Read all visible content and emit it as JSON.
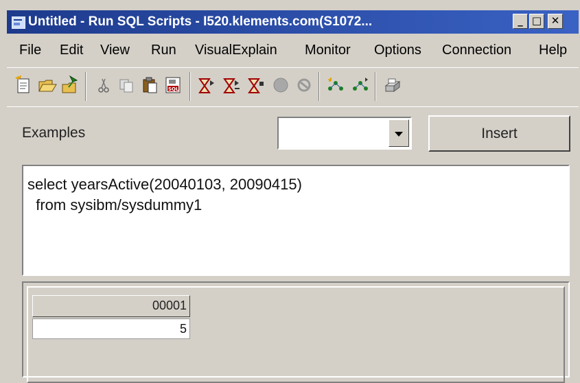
{
  "window": {
    "title": "Untitled - Run SQL Scripts - I520.klements.com(S1072...",
    "minimize_glyph": "_",
    "maximize_glyph": "□",
    "close_glyph": "✕"
  },
  "menu": [
    "File",
    "Edit",
    "View",
    "Run",
    "VisualExplain",
    "Monitor",
    "Options",
    "Connection",
    "Help"
  ],
  "toolbar": {
    "icons": [
      "new-script-icon",
      "open-folder-icon",
      "save-icon",
      "cut-icon",
      "copy-icon",
      "paste-icon",
      "insert-sql-icon",
      "run-all-icon",
      "run-from-selected-icon",
      "run-selected-icon",
      "stop-icon",
      "cancel-icon",
      "visual-explain-icon",
      "run-and-explain-icon",
      "print-icon"
    ]
  },
  "examples": {
    "label": "Examples",
    "selected": "",
    "insert_label": "Insert"
  },
  "editor": {
    "sql": "select yearsActive(20040103, 20090415)\n  from sysibm/sysdummy1"
  },
  "results": {
    "columns": [
      "00001"
    ],
    "rows": [
      [
        "5"
      ]
    ]
  }
}
